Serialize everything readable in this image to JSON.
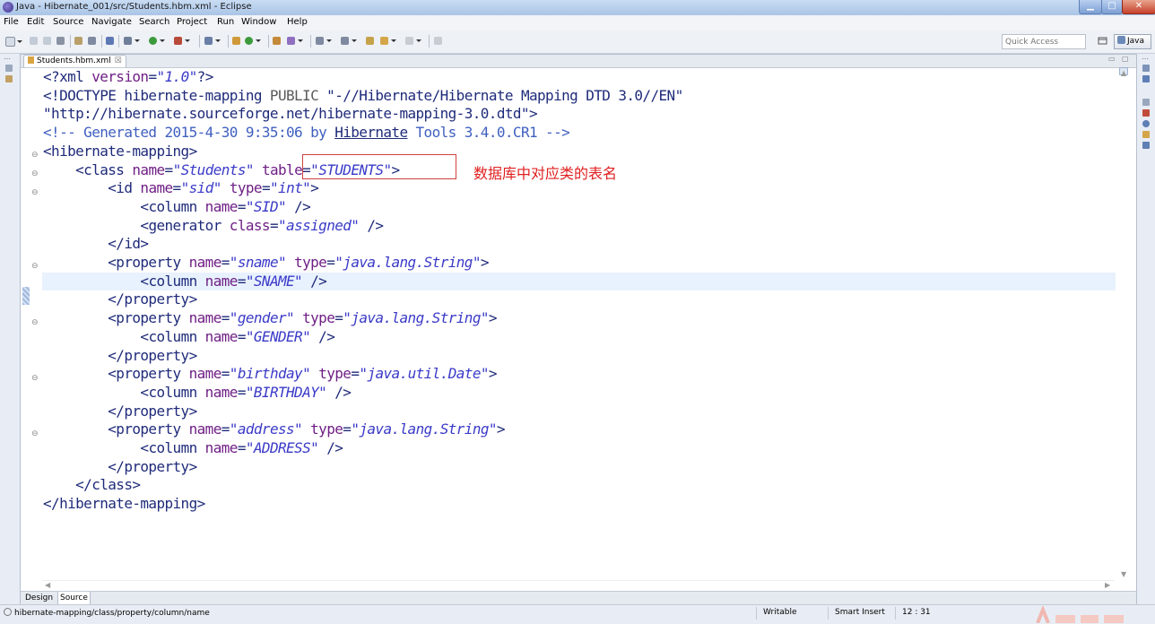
{
  "window": {
    "title": "Java - Hibernate_001/src/Students.hbm.xml - Eclipse"
  },
  "menubar": [
    "File",
    "Edit",
    "Source",
    "Navigate",
    "Search",
    "Project",
    "Run",
    "Window",
    "Help"
  ],
  "toolbar": {
    "quick_access_placeholder": "Quick Access",
    "perspective": "Java"
  },
  "editor": {
    "tab_title": "Students.hbm.xml",
    "tab_close": "☒",
    "bottom_tabs": [
      "Design",
      "Source"
    ],
    "current_line": 12,
    "lines": [
      "<?xml version=\"1.0\"?>",
      "<!DOCTYPE hibernate-mapping PUBLIC \"-//Hibernate/Hibernate Mapping DTD 3.0//EN\"",
      "\"http://hibernate.sourceforge.net/hibernate-mapping-3.0.dtd\">",
      "<!-- Generated 2015-4-30 9:35:06 by Hibernate Tools 3.4.0.CR1 -->",
      "<hibernate-mapping>",
      "    <class name=\"Students\" table=\"STUDENTS\">",
      "        <id name=\"sid\" type=\"int\">",
      "            <column name=\"SID\" />",
      "            <generator class=\"assigned\" />",
      "        </id>",
      "        <property name=\"sname\" type=\"java.lang.String\">",
      "            <column name=\"SNAME\" />",
      "        </property>",
      "        <property name=\"gender\" type=\"java.lang.String\">",
      "            <column name=\"GENDER\" />",
      "        </property>",
      "        <property name=\"birthday\" type=\"java.util.Date\">",
      "            <column name=\"BIRTHDAY\" />",
      "        </property>",
      "        <property name=\"address\" type=\"java.lang.String\">",
      "            <column name=\"ADDRESS\" />",
      "        </property>",
      "    </class>",
      "</hibernate-mapping>"
    ]
  },
  "annotation": {
    "text": "数据库中对应类的表名",
    "color": "#e02020"
  },
  "statusbar": {
    "path": "hibernate-mapping/class/property/column/name",
    "writable": "Writable",
    "insert_mode": "Smart Insert",
    "position": "12 : 31"
  },
  "colors": {
    "tag": "#1f2b7a",
    "attribute": "#6f1f85",
    "value": "#3a3ac8",
    "comment": "#3f5fbf",
    "current_line": "#e8f2fe"
  }
}
